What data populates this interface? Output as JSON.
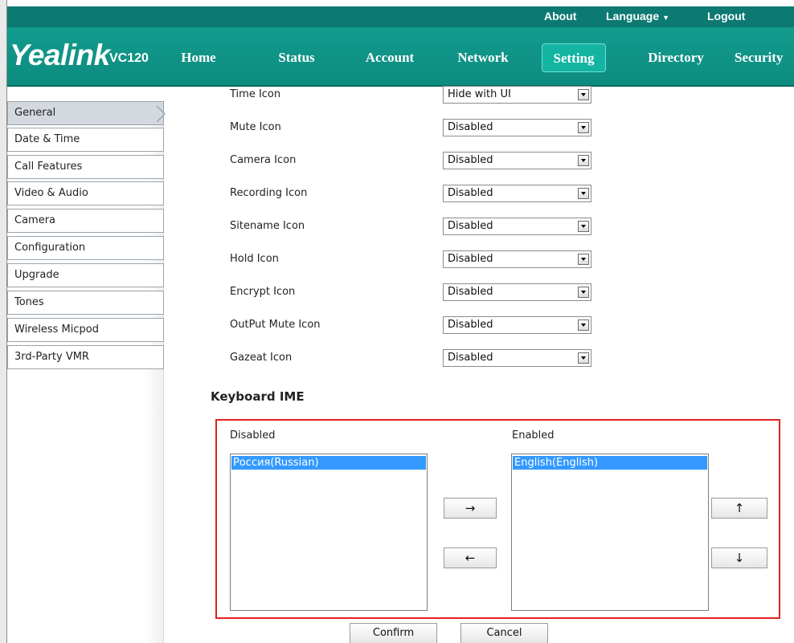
{
  "topbar": {
    "about": "About",
    "language": "Language",
    "logout": "Logout"
  },
  "header": {
    "brand": "Yealink",
    "model": "VC120",
    "nav": [
      "Home",
      "Status",
      "Account",
      "Network",
      "Setting",
      "Directory",
      "Security"
    ],
    "active_nav": "Setting"
  },
  "sidebar": {
    "items": [
      "General",
      "Date & Time",
      "Call Features",
      "Video & Audio",
      "Camera",
      "Configuration",
      "Upgrade",
      "Tones",
      "Wireless Micpod",
      "3rd-Party VMR"
    ],
    "active": "General"
  },
  "settings": [
    {
      "label": "Time Icon",
      "value": "Hide with UI"
    },
    {
      "label": "Mute Icon",
      "value": "Disabled"
    },
    {
      "label": "Camera Icon",
      "value": "Disabled"
    },
    {
      "label": "Recording Icon",
      "value": "Disabled"
    },
    {
      "label": "Sitename Icon",
      "value": "Disabled"
    },
    {
      "label": "Hold Icon",
      "value": "Disabled"
    },
    {
      "label": "Encrypt Icon",
      "value": "Disabled"
    },
    {
      "label": "OutPut Mute Icon",
      "value": "Disabled"
    },
    {
      "label": "Gazeat Icon",
      "value": "Disabled"
    }
  ],
  "keyboard_ime": {
    "title": "Keyboard IME",
    "disabled_label": "Disabled",
    "enabled_label": "Enabled",
    "disabled_items": [
      "Россия(Russian)"
    ],
    "enabled_items": [
      "English(English)"
    ],
    "move_right": "→",
    "move_left": "←",
    "move_up": "↑",
    "move_down": "↓"
  },
  "actions": {
    "confirm": "Confirm",
    "cancel": "Cancel"
  },
  "colors": {
    "topbar": "#0c7a72",
    "header": "#129c8e",
    "nav_active": "#14b4a3",
    "selection": "#3399ff",
    "highlight_box": "#e02020"
  }
}
